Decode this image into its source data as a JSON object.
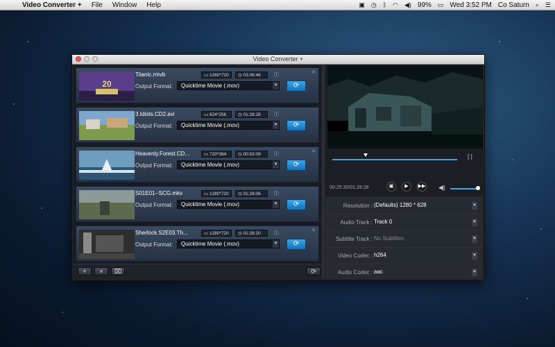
{
  "menubar": {
    "app": "Video Converter +",
    "items": [
      "File",
      "Window",
      "Help"
    ],
    "battery": "99%",
    "clock": "Wed 3:52 PM",
    "user": "Co Saturn"
  },
  "window": {
    "title": "Video Converter +"
  },
  "files": [
    {
      "name": "Titanic.rmvb",
      "resolution": "1280*720",
      "duration": "03:06:46",
      "output_label": "Output Format:",
      "format": "Quicktime Movie (.mov)"
    },
    {
      "name": "3.Idiots.CD2.avi",
      "resolution": "624*256",
      "duration": "01:28:28",
      "output_label": "Output Format:",
      "format": "Quicktime Movie (.mov)"
    },
    {
      "name": "Heavenly.Forest.CD...",
      "resolution": "720*384",
      "duration": "00:53:09",
      "output_label": "Output Format:",
      "format": "Quicktime Movie (.mov)"
    },
    {
      "name": "S01E01--SCG.mkv",
      "resolution": "1280*720",
      "duration": "01:28:06",
      "output_label": "Output Format:",
      "format": "Quicktime Movie (.mov)"
    },
    {
      "name": "Sherlock.S2E03.Th...",
      "resolution": "1280*720",
      "duration": "01:28:20",
      "output_label": "Output Format:",
      "format": "Quicktime Movie (.mov)"
    }
  ],
  "player": {
    "timecode": "00:25:30/01:28:28"
  },
  "params": [
    {
      "label": "Resolution :",
      "value": "(Defaults) 1280 * 628",
      "disabled": false
    },
    {
      "label": "Audio Track :",
      "value": "Track 0",
      "disabled": false
    },
    {
      "label": "Subtitle Track :",
      "value": "No Subtitles",
      "disabled": true
    },
    {
      "label": "Video Codec :",
      "value": "h264",
      "disabled": false
    },
    {
      "label": "Audio Codec :",
      "value": "aac",
      "disabled": false
    }
  ],
  "icons": {
    "add": "+",
    "remove": "×",
    "trash": "🗑",
    "convert": "⟳",
    "info": "i"
  }
}
